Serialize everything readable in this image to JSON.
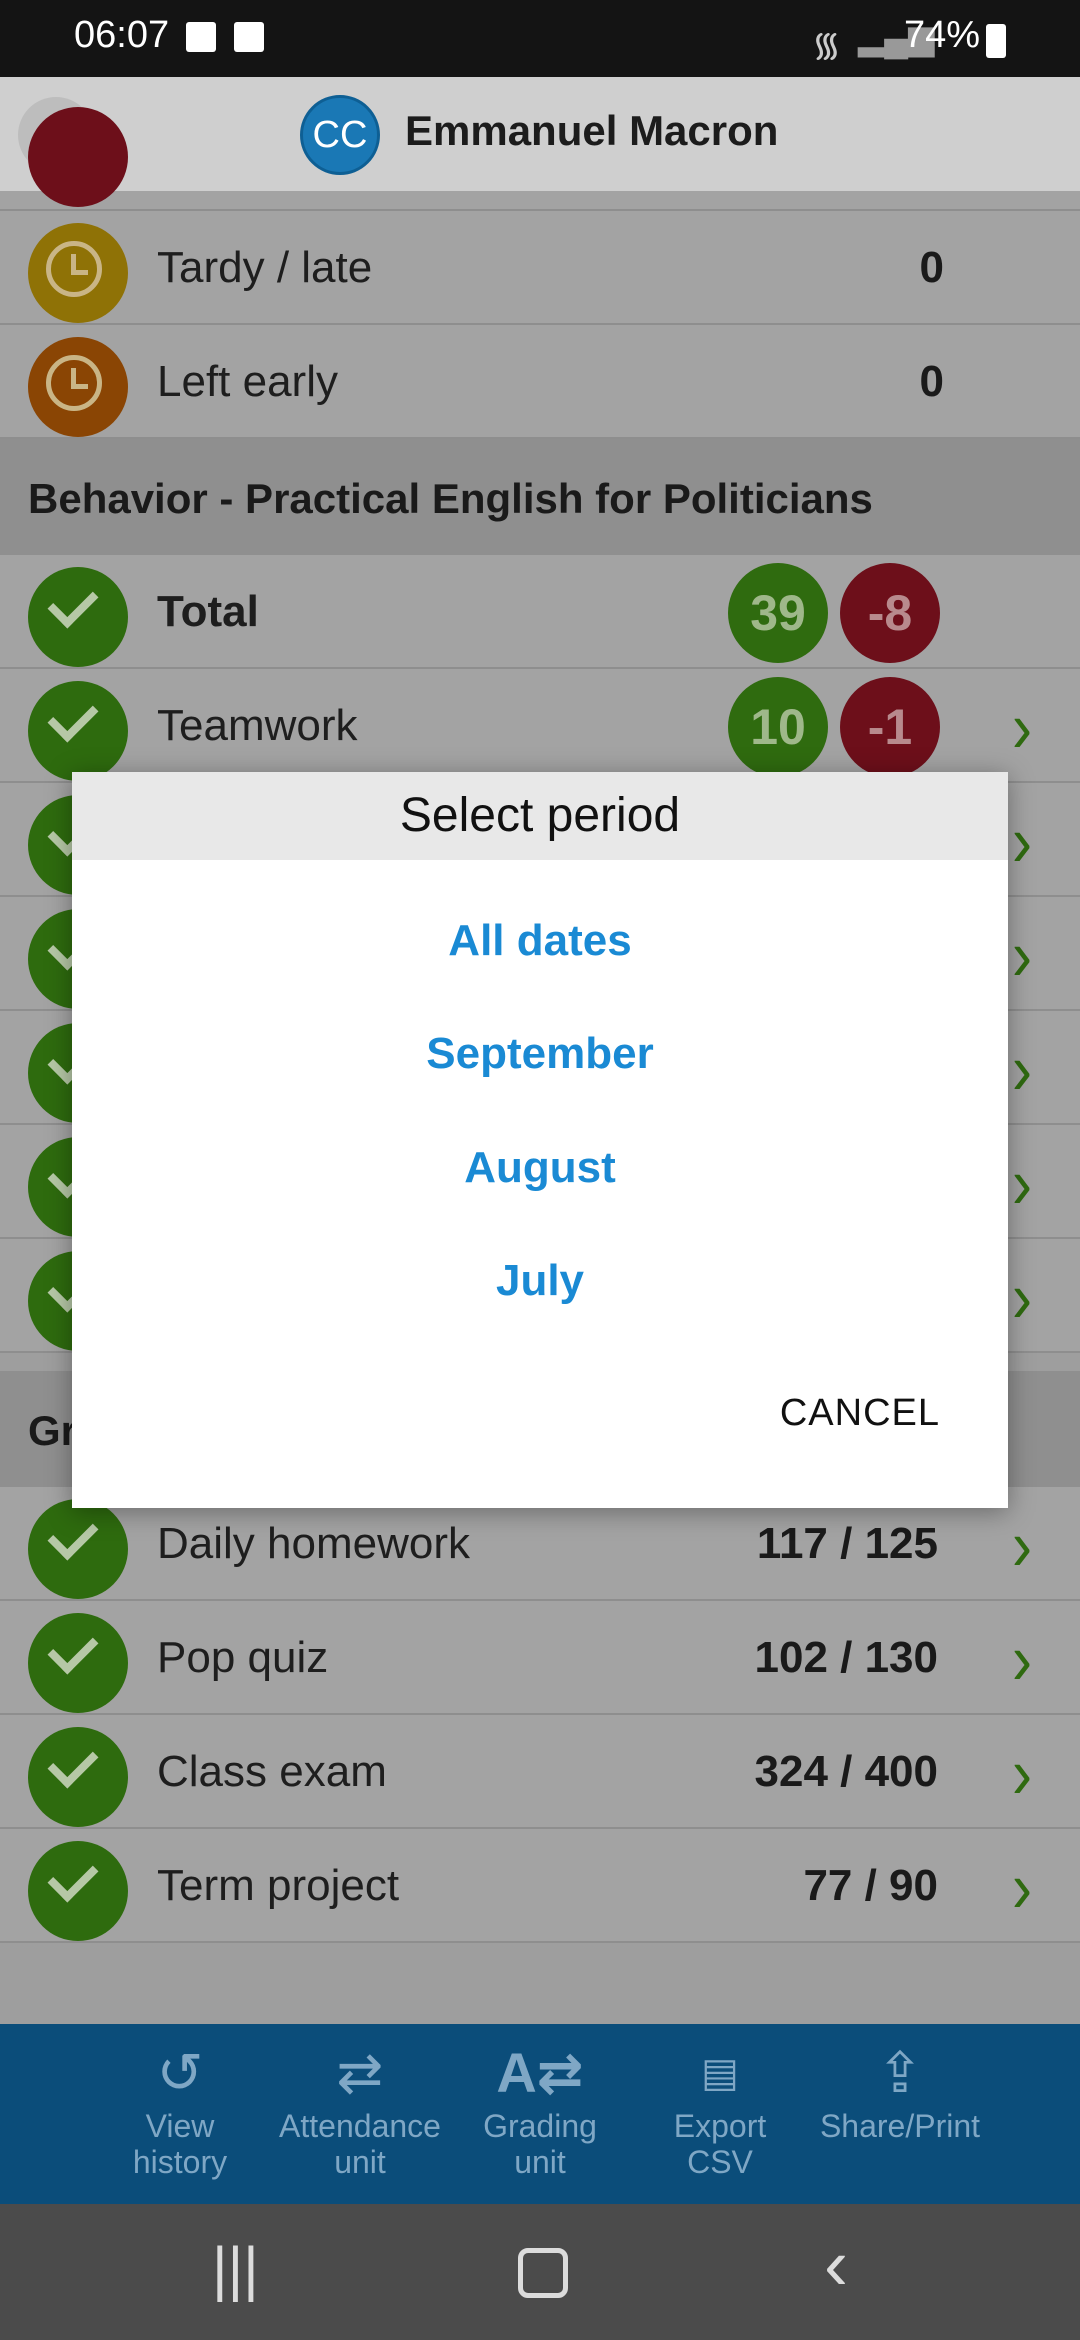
{
  "status_bar": {
    "time": "06:07",
    "battery": "74%"
  },
  "header": {
    "avatar_initials": "CC",
    "student_name": "Emmanuel Macron"
  },
  "attendance_rows": [
    {
      "label": "Tardy / late",
      "value": "0"
    },
    {
      "label": "Left early",
      "value": "0"
    }
  ],
  "behavior": {
    "section_title": "Behavior - Practical English for Politicians",
    "rows": [
      {
        "label": "Total",
        "positive": "39",
        "negative": "-8"
      },
      {
        "label": "Teamwork",
        "positive": "10",
        "negative": "-1"
      }
    ]
  },
  "grades": {
    "section_title_partial": "Gr",
    "rows": [
      {
        "label": "Daily homework",
        "value": "117 / 125"
      },
      {
        "label": "Pop quiz",
        "value": "102 / 130"
      },
      {
        "label": "Class exam",
        "value": "324 / 400"
      },
      {
        "label": "Term project",
        "value": "77 / 90"
      }
    ]
  },
  "toolbar": {
    "items": [
      {
        "label": "View\nhistory",
        "icon": "history-icon"
      },
      {
        "label": "Attendance\nunit",
        "icon": "attendance-swap-icon"
      },
      {
        "label": "Grading\nunit",
        "icon": "grading-swap-icon"
      },
      {
        "label": "Export\nCSV",
        "icon": "csv-export-icon"
      },
      {
        "label": "Share/Print",
        "icon": "share-icon"
      }
    ]
  },
  "dialog": {
    "title": "Select period",
    "options": [
      "All dates",
      "September",
      "August",
      "July"
    ],
    "cancel_label": "CANCEL"
  },
  "colors": {
    "accent_blue": "#1a8ad4",
    "toolbar_blue": "#0b4d7a",
    "positive_green": "#2f6b0f",
    "negative_red": "#6d0f1a"
  }
}
